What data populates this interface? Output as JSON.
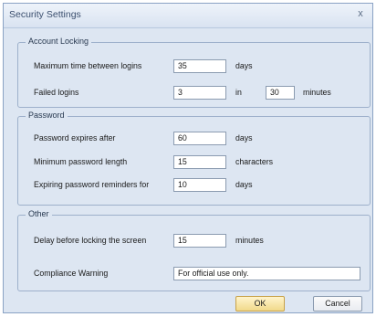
{
  "window": {
    "title": "Security Settings",
    "close_glyph": "x"
  },
  "account_locking": {
    "legend": "Account Locking",
    "max_time_label": "Maximum time between logins",
    "max_time_value": "35",
    "max_time_unit": "days",
    "failed_label": "Failed logins",
    "failed_value": "3",
    "in_label": "in",
    "failed_window_value": "30",
    "failed_window_unit": "minutes"
  },
  "password": {
    "legend": "Password",
    "expires_label": "Password expires after",
    "expires_value": "60",
    "expires_unit": "days",
    "min_length_label": "Minimum password length",
    "min_length_value": "15",
    "min_length_unit": "characters",
    "reminders_label": "Expiring password reminders for",
    "reminders_value": "10",
    "reminders_unit": "days"
  },
  "other": {
    "legend": "Other",
    "lock_delay_label": "Delay before locking the screen",
    "lock_delay_value": "15",
    "lock_delay_unit": "minutes",
    "compliance_label": "Compliance Warning",
    "compliance_value": "For official use only."
  },
  "buttons": {
    "ok": "OK",
    "cancel": "Cancel"
  }
}
